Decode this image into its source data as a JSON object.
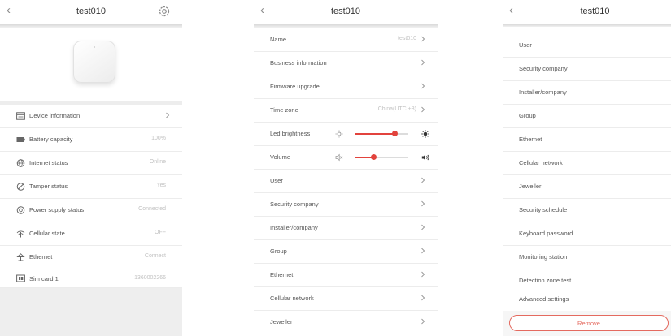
{
  "screen1": {
    "title": "test010",
    "rows": [
      {
        "label": "Device information",
        "value": "",
        "icon": "device-info-icon"
      },
      {
        "label": "Battery capacity",
        "value": "100%",
        "icon": "battery-icon"
      },
      {
        "label": "Internet status",
        "value": "Online",
        "icon": "globe-icon"
      },
      {
        "label": "Tamper status",
        "value": "Yes",
        "icon": "tamper-icon"
      },
      {
        "label": "Power supply status",
        "value": "Connected",
        "icon": "power-supply-icon"
      },
      {
        "label": "Cellular state",
        "value": "OFF",
        "icon": "cellular-icon"
      },
      {
        "label": "Ethernet",
        "value": "Connect",
        "icon": "ethernet-icon"
      },
      {
        "label": "Sim card 1",
        "value": "1360002266",
        "icon": "sim-card-icon"
      }
    ]
  },
  "screen2": {
    "title": "test010",
    "rows": [
      {
        "label": "Name",
        "value": "test010"
      },
      {
        "label": "Business information",
        "value": ""
      },
      {
        "label": "Firmware upgrade",
        "value": ""
      },
      {
        "label": "Time zone",
        "value": "China(UTC +8)"
      },
      {
        "label": "Led brightness",
        "slider": 0.75
      },
      {
        "label": "Volume",
        "slider": 0.35
      },
      {
        "label": "User",
        "value": ""
      },
      {
        "label": "Security company",
        "value": ""
      },
      {
        "label": "Installer/company",
        "value": ""
      },
      {
        "label": "Group",
        "value": ""
      },
      {
        "label": "Ethernet",
        "value": ""
      },
      {
        "label": "Cellular network",
        "value": ""
      },
      {
        "label": "Jeweller",
        "value": ""
      }
    ]
  },
  "screen3": {
    "title": "test010",
    "rows": [
      {
        "label": "User"
      },
      {
        "label": "Security company"
      },
      {
        "label": "Installer/company"
      },
      {
        "label": "Group"
      },
      {
        "label": "Ethernet"
      },
      {
        "label": "Cellular network"
      },
      {
        "label": "Jeweller"
      },
      {
        "label": "Security schedule"
      },
      {
        "label": "Keyboard password"
      },
      {
        "label": "Monitoring station"
      },
      {
        "label": "Detection zone test"
      },
      {
        "label": "Advanced settings"
      }
    ],
    "remove_label": "Remove"
  },
  "colors": {
    "accent": "#e2433d",
    "remove": "#e46a5f",
    "muted": "#c2c2c2"
  },
  "icons": {
    "back": "back-arrow-icon",
    "settings": "gear-icon",
    "chevron": "chevron-right-icon"
  }
}
